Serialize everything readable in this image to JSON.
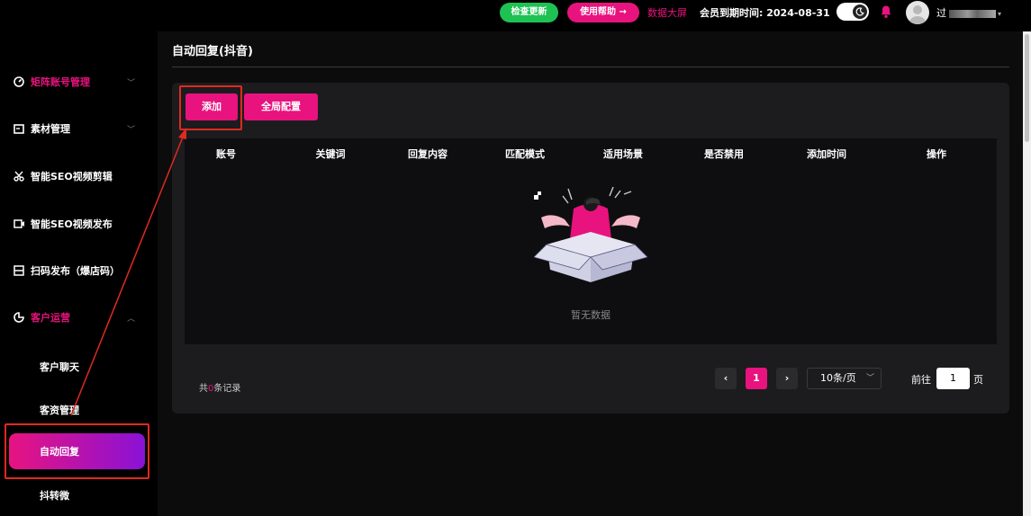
{
  "topbar": {
    "check_update": "检查更新",
    "help": "使用帮助 →",
    "dashboard": "数据大屏",
    "expire_label": "会员到期时间:",
    "expire_date": "2024-08-31",
    "username_initial": "过"
  },
  "sidebar": {
    "items": [
      {
        "label": "矩阵账号管理",
        "icon": "dashboard-icon"
      },
      {
        "label": "素材管理",
        "icon": "folder-icon"
      },
      {
        "label": "智能SEO视频剪辑",
        "icon": "scissors-icon"
      },
      {
        "label": "智能SEO视频发布",
        "icon": "video-icon"
      },
      {
        "label": "扫码发布（爆店码）",
        "icon": "qrcode-icon"
      },
      {
        "label": "客户运营",
        "icon": "pie-icon"
      }
    ],
    "sub_items": [
      {
        "label": "客户聊天"
      },
      {
        "label": "客资管理"
      },
      {
        "label": "自动回复"
      },
      {
        "label": "抖转微"
      }
    ]
  },
  "main": {
    "title": "自动回复(抖音)",
    "add_button": "添加",
    "global_button": "全局配置",
    "columns": [
      "账号",
      "关键词",
      "回复内容",
      "匹配模式",
      "适用场景",
      "是否禁用",
      "添加时间",
      "操作"
    ],
    "empty_text": "暂无数据",
    "total_prefix": "共",
    "total_count": "0",
    "total_suffix": "条记录",
    "page_current": "1",
    "page_size": "10条/页",
    "goto_label": "前往",
    "goto_value": "1",
    "goto_unit": "页"
  },
  "colors": {
    "accent": "#e8137e",
    "green": "#1ec253",
    "gradient_end": "#8a12d6",
    "annotation": "#e0291f"
  }
}
